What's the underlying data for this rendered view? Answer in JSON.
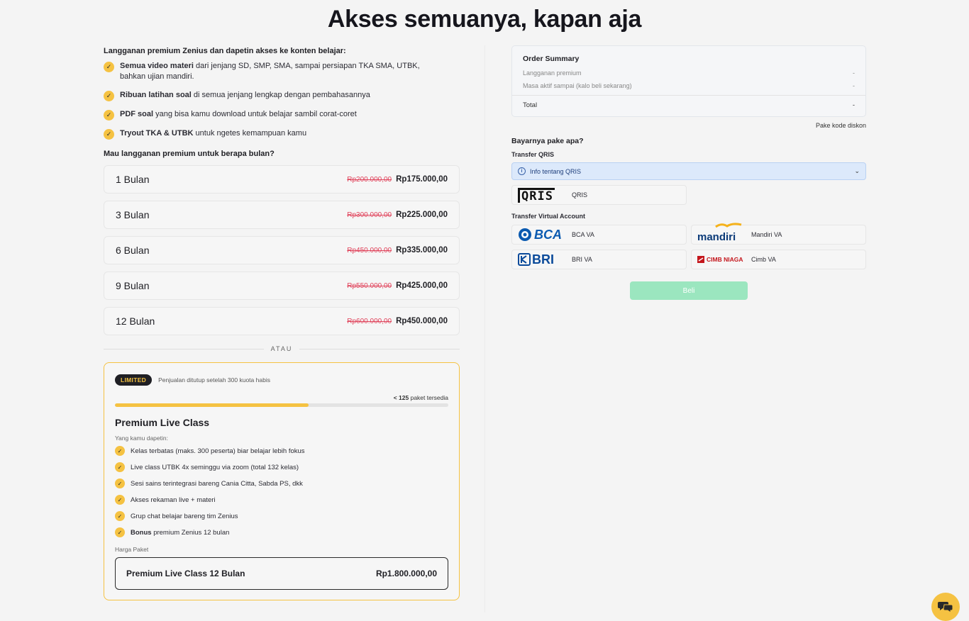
{
  "page": {
    "title": "Akses semuanya, kapan aja"
  },
  "left": {
    "intro": "Langganan premium Zenius dan dapetin akses ke konten belajar:",
    "benefits": [
      {
        "bold": "Semua video materi",
        "rest": " dari jenjang SD, SMP, SMA, sampai persiapan TKA SMA, UTBK,",
        "rest2": "bahkan ujian mandiri."
      },
      {
        "bold": "Ribuan latihan soal",
        "rest": " di semua jenjang lengkap dengan pembahasannya"
      },
      {
        "bold": "PDF soal",
        "rest": " yang bisa kamu download untuk belajar sambil corat-coret"
      },
      {
        "bold": "Tryout TKA & UTBK",
        "rest": " untuk ngetes kemampuan kamu"
      }
    ],
    "plans_question": "Mau langganan premium untuk berapa bulan?",
    "plans": [
      {
        "name": "1 Bulan",
        "original": "Rp200.000,00",
        "price": "Rp175.000,00"
      },
      {
        "name": "3 Bulan",
        "original": "Rp300.000,00",
        "price": "Rp225.000,00"
      },
      {
        "name": "6 Bulan",
        "original": "Rp450.000,00",
        "price": "Rp335.000,00"
      },
      {
        "name": "9 Bulan",
        "original": "Rp550.000,00",
        "price": "Rp425.000,00"
      },
      {
        "name": "12 Bulan",
        "original": "Rp600.000,00",
        "price": "Rp450.000,00"
      }
    ],
    "or_text": "ATAU",
    "live_class": {
      "badge": "LIMITED",
      "note": "Penjualan ditutup setelah 300 kuota habis",
      "stock_bold": "< 125",
      "stock_rest": " paket tersedia",
      "progress_percent": 58,
      "title": "Premium Live Class",
      "you_get": "Yang kamu dapetin:",
      "features": [
        {
          "bold": "",
          "rest": "Kelas terbatas (maks. 300 peserta) biar belajar lebih fokus"
        },
        {
          "bold": "",
          "rest": "Live class UTBK 4x seminggu via zoom (total 132 kelas)"
        },
        {
          "bold": "",
          "rest": "Sesi sains terintegrasi bareng Cania Citta, Sabda PS, dkk"
        },
        {
          "bold": "",
          "rest": "Akses rekaman live + materi"
        },
        {
          "bold": "",
          "rest": "Grup chat belajar bareng tim Zenius"
        },
        {
          "bold": "Bonus",
          "rest": " premium Zenius 12 bulan"
        }
      ],
      "price_label": "Harga Paket",
      "package_name": "Premium Live Class 12 Bulan",
      "package_price": "Rp1.800.000,00"
    }
  },
  "right": {
    "summary": {
      "title": "Order Summary",
      "rows": [
        {
          "label": "Langganan premium",
          "value": "-"
        },
        {
          "label": "Masa aktif sampai (kalo beli sekarang)",
          "value": "-"
        }
      ],
      "total_label": "Total",
      "total_value": "-"
    },
    "discount_link": "Pake kode diskon",
    "pay_question": "Bayarnya pake apa?",
    "qris_group": "Transfer QRIS",
    "qris_info": "Info tentang QRIS",
    "qris_logo": "QRIS",
    "qris_label": "QRIS",
    "va_group": "Transfer Virtual Account",
    "va_options": [
      {
        "logo": "BCA",
        "label": "BCA VA"
      },
      {
        "logo": "mandiri",
        "label": "Mandiri VA"
      },
      {
        "logo": "BRI",
        "label": "BRI VA"
      },
      {
        "logo": "CIMB NIAGA",
        "label": "Cimb VA"
      }
    ],
    "buy_label": "Beli"
  },
  "colors": {
    "accent_yellow": "#f5c242",
    "strike_red": "#e0435b",
    "buy_green": "#9be6bf",
    "info_blue": "#dce9fb",
    "bca_blue": "#0b5ab0",
    "bri_blue": "#0a4a9a",
    "mandiri_navy": "#0b3a78",
    "cimb_red": "#c4161c"
  },
  "icons": {
    "check": "check-icon",
    "info": "info-icon",
    "chevron": "chevron-down-icon",
    "chat": "chat-icon"
  }
}
